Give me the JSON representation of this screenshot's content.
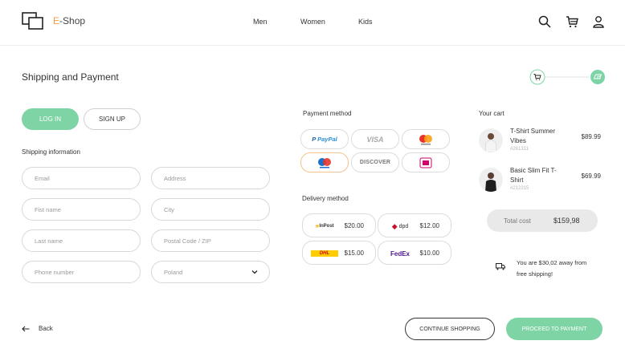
{
  "header": {
    "logo_prefix": "E",
    "logo_suffix": "-Shop",
    "nav": [
      "Men",
      "Women",
      "Kids"
    ],
    "icons": [
      "search-icon",
      "cart-icon",
      "user-icon"
    ]
  },
  "page": {
    "title": "Shipping and Payment"
  },
  "auth": {
    "login_label": "LOG IN",
    "signup_label": "SIGN UP"
  },
  "shipping": {
    "title": "Shipping information",
    "fields": {
      "email": "Email",
      "address": "Address",
      "first_name": "Fist name",
      "city": "City",
      "last_name": "Last name",
      "postal": "Postal Code / ZIP",
      "phone": "Phone number",
      "country": "Poland"
    }
  },
  "payment": {
    "title": "Payment method",
    "options": [
      "PayPal",
      "VISA",
      "Mastercard",
      "Maestro",
      "DISCOVER",
      "iDEAL"
    ],
    "selected": "Maestro"
  },
  "delivery": {
    "title": "Delivery method",
    "options": [
      {
        "carrier": "InPost",
        "price": "$20.00"
      },
      {
        "carrier": "dpd",
        "price": "$12.00"
      },
      {
        "carrier": "DHL",
        "price": "$15.00"
      },
      {
        "carrier": "FedEx",
        "price": "$10.00"
      }
    ]
  },
  "cart": {
    "title": "Your cart",
    "items": [
      {
        "name": "T-Shirt Summer Vibes",
        "sku": "#261311",
        "price": "$89.99"
      },
      {
        "name": "Basic Slim Fit T-Shirt",
        "sku": "#212315",
        "price": "$69.99"
      }
    ],
    "total_label": "Total cost",
    "total_value": "$159,98",
    "free_shipping": "You are $30,02 away from free shipping!"
  },
  "footer": {
    "back_label": "Back",
    "continue_label": "CONTINUE SHOPPING",
    "proceed_label": "PROCEED TO PAYMENT"
  },
  "colors": {
    "accent": "#7fd4a6",
    "logo_accent": "#f39a3a"
  }
}
